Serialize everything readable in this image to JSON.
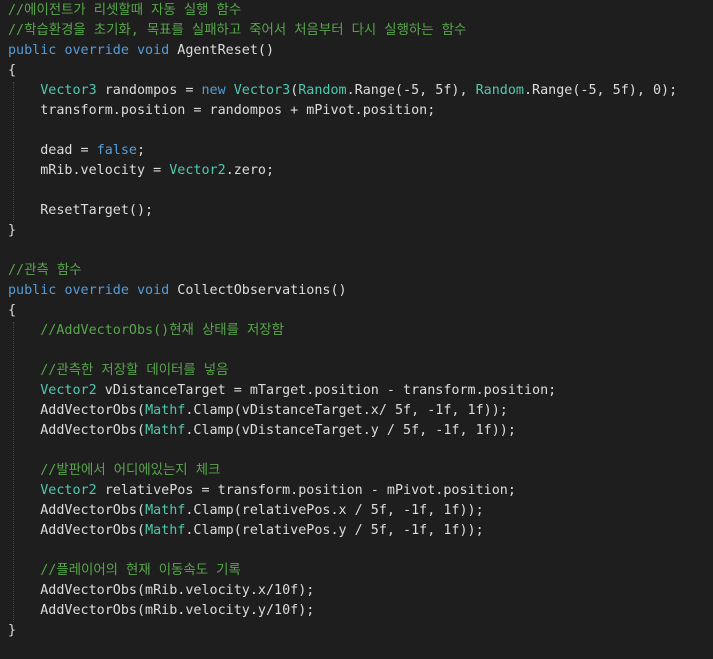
{
  "editor": {
    "lines": [
      [
        {
          "t": "//에이전트가 리셋할때 자동 실행 함수",
          "k": "comment"
        }
      ],
      [
        {
          "t": "//학습환경을 초기화, 목표를 실패하고 죽어서 처음부터 다시 실행하는 함수",
          "k": "comment"
        }
      ],
      [
        {
          "t": "public",
          "k": "keyword"
        },
        {
          "t": " ",
          "k": "plain"
        },
        {
          "t": "override",
          "k": "keyword"
        },
        {
          "t": " ",
          "k": "plain"
        },
        {
          "t": "void",
          "k": "keyword"
        },
        {
          "t": " AgentReset()",
          "k": "plain"
        }
      ],
      [
        {
          "t": "{",
          "k": "plain"
        }
      ],
      [
        {
          "t": "    ",
          "k": "plain"
        },
        {
          "t": "Vector3",
          "k": "type"
        },
        {
          "t": " randompos = ",
          "k": "plain"
        },
        {
          "t": "new",
          "k": "keyword"
        },
        {
          "t": " ",
          "k": "plain"
        },
        {
          "t": "Vector3",
          "k": "type"
        },
        {
          "t": "(",
          "k": "plain"
        },
        {
          "t": "Random",
          "k": "type"
        },
        {
          "t": ".Range(-5, 5f), ",
          "k": "plain"
        },
        {
          "t": "Random",
          "k": "type"
        },
        {
          "t": ".Range(-5, 5f), 0);",
          "k": "plain"
        }
      ],
      [
        {
          "t": "    transform.position = randompos + mPivot.position;",
          "k": "plain"
        }
      ],
      [
        {
          "t": "",
          "k": "plain"
        }
      ],
      [
        {
          "t": "    dead = ",
          "k": "plain"
        },
        {
          "t": "false",
          "k": "keyword"
        },
        {
          "t": ";",
          "k": "plain"
        }
      ],
      [
        {
          "t": "    mRib.velocity = ",
          "k": "plain"
        },
        {
          "t": "Vector2",
          "k": "type"
        },
        {
          "t": ".zero;",
          "k": "plain"
        }
      ],
      [
        {
          "t": "",
          "k": "plain"
        }
      ],
      [
        {
          "t": "    ResetTarget();",
          "k": "plain"
        }
      ],
      [
        {
          "t": "}",
          "k": "plain"
        }
      ],
      [
        {
          "t": "",
          "k": "plain"
        }
      ],
      [
        {
          "t": "//관측 함수",
          "k": "comment"
        }
      ],
      [
        {
          "t": "public",
          "k": "keyword"
        },
        {
          "t": " ",
          "k": "plain"
        },
        {
          "t": "override",
          "k": "keyword"
        },
        {
          "t": " ",
          "k": "plain"
        },
        {
          "t": "void",
          "k": "keyword"
        },
        {
          "t": " CollectObservations()",
          "k": "plain"
        }
      ],
      [
        {
          "t": "{",
          "k": "plain"
        }
      ],
      [
        {
          "t": "    ",
          "k": "plain"
        },
        {
          "t": "//AddVectorObs()현재 상태를 저장함",
          "k": "comment"
        }
      ],
      [
        {
          "t": "",
          "k": "plain"
        }
      ],
      [
        {
          "t": "    ",
          "k": "plain"
        },
        {
          "t": "//관측한 저장할 데이터를 넣음",
          "k": "comment"
        }
      ],
      [
        {
          "t": "    ",
          "k": "plain"
        },
        {
          "t": "Vector2",
          "k": "type"
        },
        {
          "t": " vDistanceTarget = mTarget.position - transform.position;",
          "k": "plain"
        }
      ],
      [
        {
          "t": "    AddVectorObs(",
          "k": "plain"
        },
        {
          "t": "Mathf",
          "k": "type"
        },
        {
          "t": ".Clamp(vDistanceTarget.x/ 5f, -1f, 1f));",
          "k": "plain"
        }
      ],
      [
        {
          "t": "    AddVectorObs(",
          "k": "plain"
        },
        {
          "t": "Mathf",
          "k": "type"
        },
        {
          "t": ".Clamp(vDistanceTarget.y / 5f, -1f, 1f));",
          "k": "plain"
        }
      ],
      [
        {
          "t": "",
          "k": "plain"
        }
      ],
      [
        {
          "t": "    ",
          "k": "plain"
        },
        {
          "t": "//발판에서 어디에있는지 체크",
          "k": "comment"
        }
      ],
      [
        {
          "t": "    ",
          "k": "plain"
        },
        {
          "t": "Vector2",
          "k": "type"
        },
        {
          "t": " relativePos = transform.position - mPivot.position;",
          "k": "plain"
        }
      ],
      [
        {
          "t": "    AddVectorObs(",
          "k": "plain"
        },
        {
          "t": "Mathf",
          "k": "type"
        },
        {
          "t": ".Clamp(relativePos.x / 5f, -1f, 1f));",
          "k": "plain"
        }
      ],
      [
        {
          "t": "    AddVectorObs(",
          "k": "plain"
        },
        {
          "t": "Mathf",
          "k": "type"
        },
        {
          "t": ".Clamp(relativePos.y / 5f, -1f, 1f));",
          "k": "plain"
        }
      ],
      [
        {
          "t": "",
          "k": "plain"
        }
      ],
      [
        {
          "t": "    ",
          "k": "plain"
        },
        {
          "t": "//플레이어의 현재 이동속도 기록",
          "k": "comment"
        }
      ],
      [
        {
          "t": "    AddVectorObs(mRib.velocity.x/10f);",
          "k": "plain"
        }
      ],
      [
        {
          "t": "    AddVectorObs(mRib.velocity.y/10f);",
          "k": "plain"
        }
      ],
      [
        {
          "t": "}",
          "k": "plain"
        }
      ]
    ]
  },
  "colors": {
    "background": "#1e1e1e",
    "comment": "#57a64a",
    "keyword": "#569cd6",
    "type": "#4ec9b0",
    "plain": "#dcdcdc"
  }
}
